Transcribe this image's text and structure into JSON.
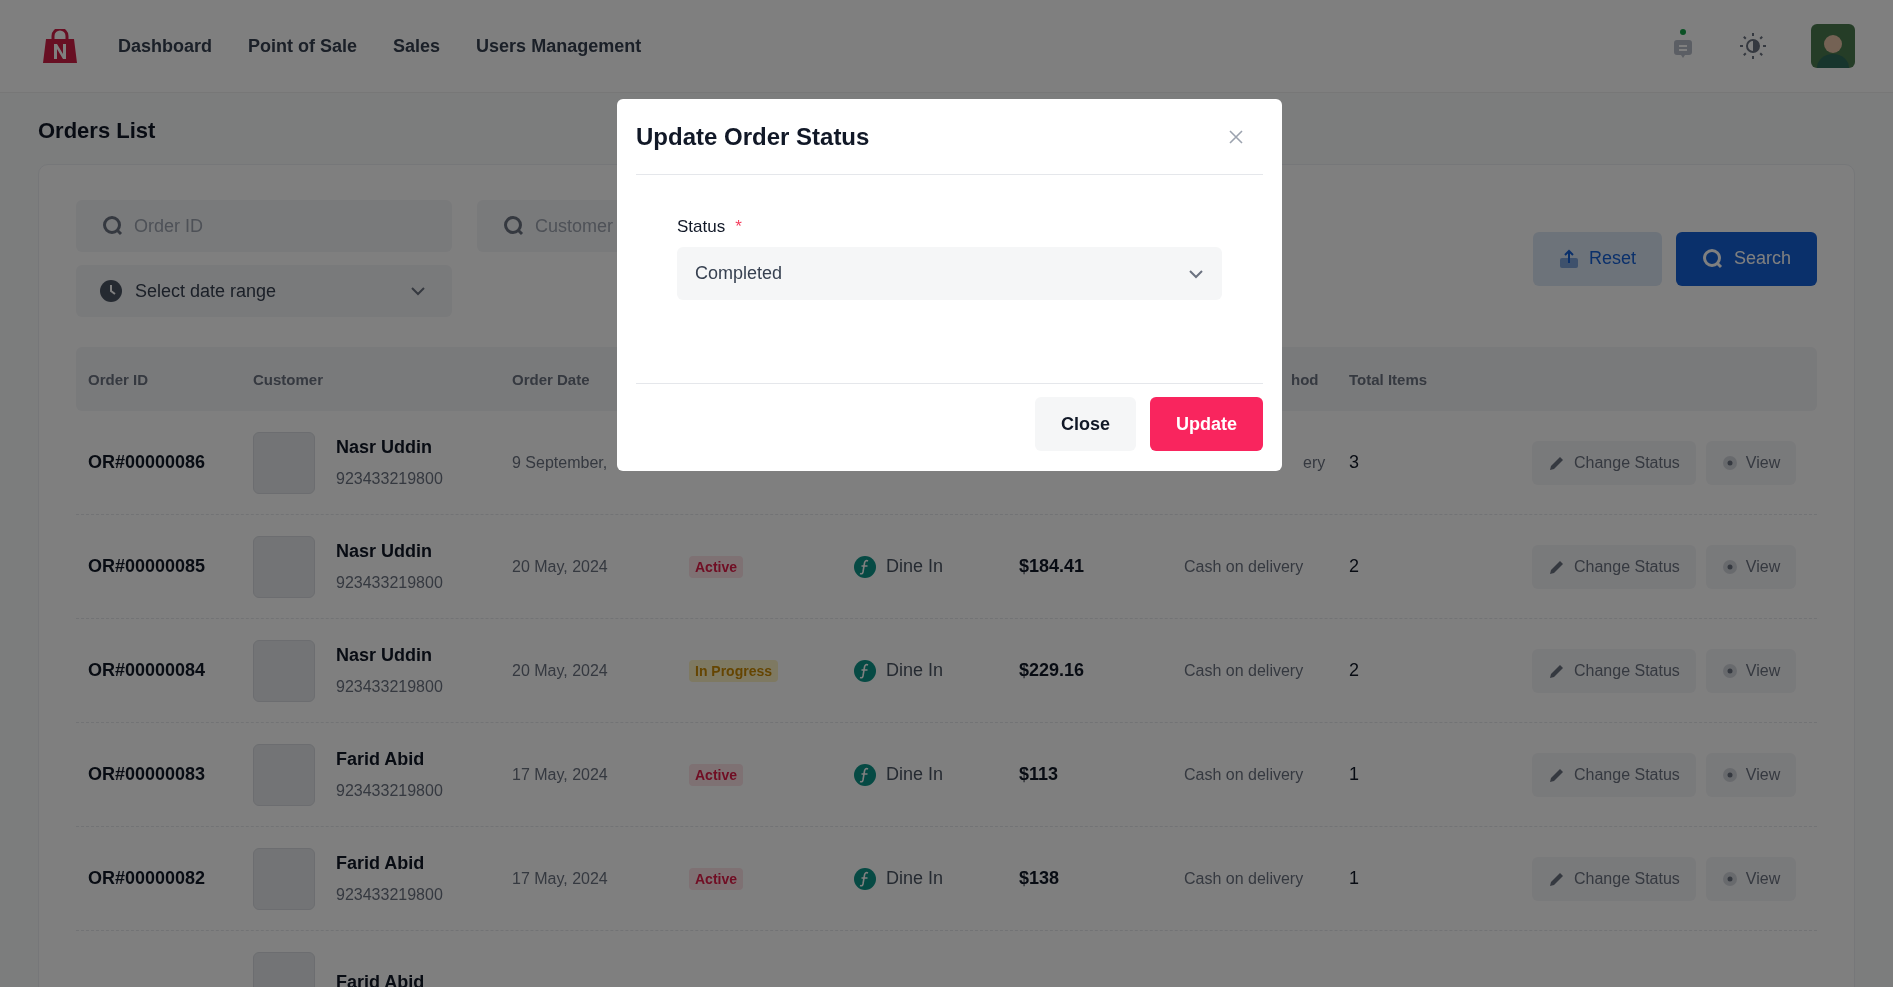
{
  "nav": {
    "links": [
      "Dashboard",
      "Point of Sale",
      "Sales",
      "Users Management"
    ]
  },
  "page_title": "Orders List",
  "filters": {
    "order_id": {
      "placeholder": "Order ID"
    },
    "customer": {
      "placeholder": "Customer"
    },
    "date_range": {
      "placeholder": "Select date range"
    },
    "buttons": [
      {
        "label": "Reset",
        "kind": "secondary"
      },
      {
        "label": "Search",
        "kind": "primary"
      }
    ]
  },
  "table": {
    "columns": {
      "order_id": "Order ID",
      "customer": "Customer",
      "order_date": "Order Date",
      "column_7": "hod",
      "total_items": "Total Items"
    },
    "rows": [
      {
        "order_id": "OR#00000086",
        "customer": "Nasr Uddin",
        "phone": "923433219800",
        "date": "9 September,",
        "covered": true,
        "payment": "ery",
        "items": "3",
        "actions": [
          "Change Status",
          "View"
        ]
      },
      {
        "order_id": "OR#00000085",
        "customer": "Nasr Uddin",
        "phone": "923433219800",
        "date": "20 May, 2024",
        "status": {
          "label": "Active",
          "kind": "active"
        },
        "type": "Dine In",
        "amount": "$184.41",
        "payment": "Cash on delivery",
        "items": "2",
        "actions": [
          "Change Status",
          "View"
        ]
      },
      {
        "order_id": "OR#00000084",
        "customer": "Nasr Uddin",
        "phone": "923433219800",
        "date": "20 May, 2024",
        "status": {
          "label": "In Progress",
          "kind": "in_progress"
        },
        "type": "Dine In",
        "amount": "$229.16",
        "payment": "Cash on delivery",
        "items": "2",
        "actions": [
          "Change Status",
          "View"
        ]
      },
      {
        "order_id": "OR#00000083",
        "customer": "Farid Abid",
        "phone": "923433219800",
        "date": "17 May, 2024",
        "status": {
          "label": "Active",
          "kind": "active"
        },
        "type": "Dine In",
        "amount": "$113",
        "payment": "Cash on delivery",
        "items": "1",
        "actions": [
          "Change Status",
          "View"
        ]
      },
      {
        "order_id": "OR#00000082",
        "customer": "Farid Abid",
        "phone": "923433219800",
        "date": "17 May, 2024",
        "status": {
          "label": "Active",
          "kind": "active"
        },
        "type": "Dine In",
        "amount": "$138",
        "payment": "Cash on delivery",
        "items": "1",
        "actions": [
          "Change Status",
          "View"
        ]
      },
      {
        "customer": "Farid Abid"
      }
    ]
  },
  "modal": {
    "title": "Update Order Status",
    "field": {
      "label": "Status",
      "required_mark": "*",
      "value": "Completed"
    },
    "buttons": [
      {
        "label": "Close",
        "kind": "secondary"
      },
      {
        "label": "Update",
        "kind": "primary"
      }
    ]
  }
}
